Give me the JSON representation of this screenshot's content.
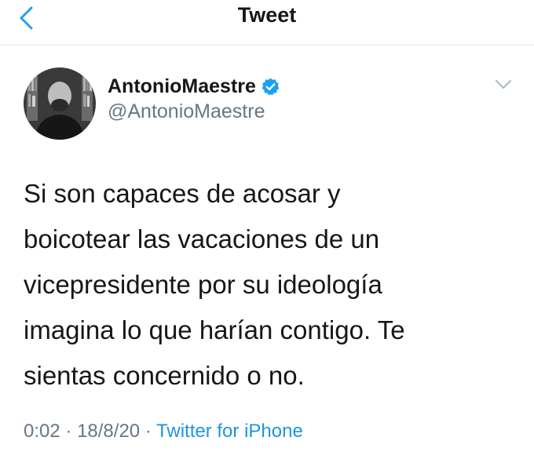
{
  "header": {
    "title": "Tweet",
    "back_icon": "chevron-left-icon"
  },
  "tweet": {
    "display_name": "AntonioMaestre",
    "handle": "@AntonioMaestre",
    "verified_icon": "verified-badge-icon",
    "more_icon": "chevron-down-icon",
    "text_lines": [
      "Si son capaces de acosar y",
      "boicotear las vacaciones de un",
      "vicepresidente por su ideología",
      "imagina lo que harían contigo. Te",
      "sientas concernido o no."
    ],
    "time": "0:02",
    "date": "18/8/20",
    "separator": "·",
    "source": "Twitter for iPhone"
  },
  "colors": {
    "accent": "#1da1f2",
    "text_primary": "#14171a",
    "text_secondary": "#657786",
    "link": "#1b95e0"
  }
}
